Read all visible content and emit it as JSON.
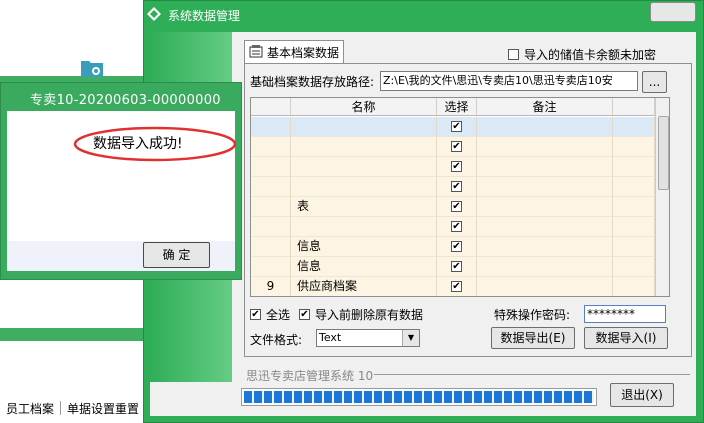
{
  "window": {
    "title": "系统数据管理"
  },
  "background": {
    "brand_text": "思迅",
    "links": [
      "员工档案",
      "单据设置重置"
    ]
  },
  "tab": {
    "label": "基本档案数据"
  },
  "options": {
    "stored_value_unencrypted": "导入的储值卡余额未加密",
    "path_label": "基础档案数据存放路径:",
    "path_value": "Z:\\E\\我的文件\\思迅\\专卖店10\\思迅专卖店10安",
    "browse_label": "..."
  },
  "grid": {
    "headers": {
      "name": "名称",
      "select": "选择",
      "note": "备注"
    },
    "rows": [
      {
        "no": "",
        "name": "",
        "checked": "✔"
      },
      {
        "no": "",
        "name": "",
        "checked": "✔"
      },
      {
        "no": "",
        "name": "",
        "checked": "✔"
      },
      {
        "no": "",
        "name": "",
        "checked": "✔"
      },
      {
        "no": "",
        "name": "表",
        "checked": "✔"
      },
      {
        "no": "",
        "name": "",
        "checked": "✔"
      },
      {
        "no": "",
        "name": "信息",
        "checked": "✔"
      },
      {
        "no": "",
        "name": "信息",
        "checked": "✔"
      },
      {
        "no": "9",
        "name": "供应商档案",
        "checked": "✔"
      }
    ]
  },
  "bottom": {
    "select_all": "全选",
    "delete_before_import": "导入前删除原有数据",
    "password_label": "特殊操作密码:",
    "password_value": "********",
    "format_label": "文件格式:",
    "format_value": "Text",
    "export_btn": "数据导出(E)",
    "import_btn": "数据导入(I)"
  },
  "status": {
    "text": "思迅专卖店管理系统 10",
    "progress": 1.0
  },
  "exit_btn": "退出(X)",
  "dialog": {
    "title": "专卖10-20200603-00000000",
    "message": "数据导入成功!",
    "ok": "确 定"
  },
  "colors": {
    "window_green": "#2fae58",
    "dialog_green": "#3aaa5e",
    "row_bg": "#fdf5e3",
    "highlight_row": "#dbe8f6",
    "progress_blue": "#1b78d8",
    "annotation_red": "#e03030"
  }
}
